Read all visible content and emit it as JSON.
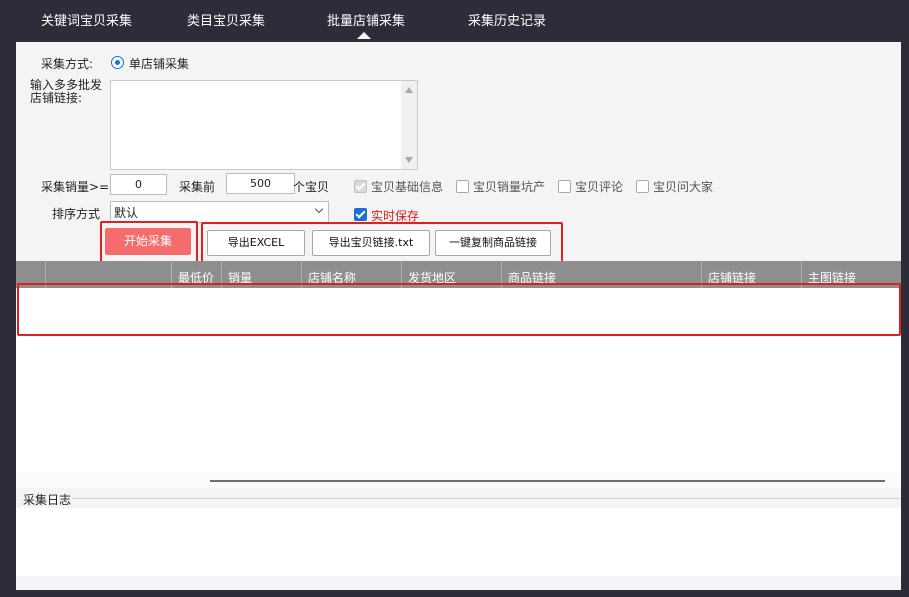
{
  "tabs": [
    {
      "label": "关键词宝贝采集"
    },
    {
      "label": "类目宝贝采集"
    },
    {
      "label": "批量店铺采集"
    },
    {
      "label": "采集历史记录"
    }
  ],
  "form": {
    "mode_label": "采集方式:",
    "mode_option": "单店铺采集",
    "links_label_line1": "输入多多批发",
    "links_label_line2": "店铺链接:",
    "sales_label": "采集销量>=",
    "sales_value": "0",
    "collect_front_label": "采集前",
    "collect_count": "500",
    "items_label": "个宝贝",
    "checkboxes": [
      {
        "label": "宝贝基础信息",
        "checked": true
      },
      {
        "label": "宝贝销量坑产",
        "checked": false
      },
      {
        "label": "宝贝评论",
        "checked": false
      },
      {
        "label": "宝贝问大家",
        "checked": false
      }
    ],
    "sort_label": "排序方式",
    "sort_value": "默认",
    "realtime_save_label": "实时保存",
    "realtime_save_checked": true
  },
  "buttons": {
    "start": "开始采集",
    "export_excel": "导出EXCEL",
    "export_links": "导出宝贝链接.txt",
    "copy_links": "一键复制商品链接"
  },
  "table": {
    "columns": [
      "",
      "",
      "最低价",
      "销量",
      "店铺名称",
      "发货地区",
      "商品链接",
      "店铺链接",
      "主图链接"
    ]
  },
  "log": {
    "title": "采集日志"
  },
  "colors": {
    "tabbar_bg": "#2d2d3a",
    "panel_bg": "#f4f4f4",
    "accent_blue": "#1a6fd1",
    "start_button": "#f46c6c",
    "highlight_red": "#e0201f",
    "table_header": "#8e8e8e"
  }
}
